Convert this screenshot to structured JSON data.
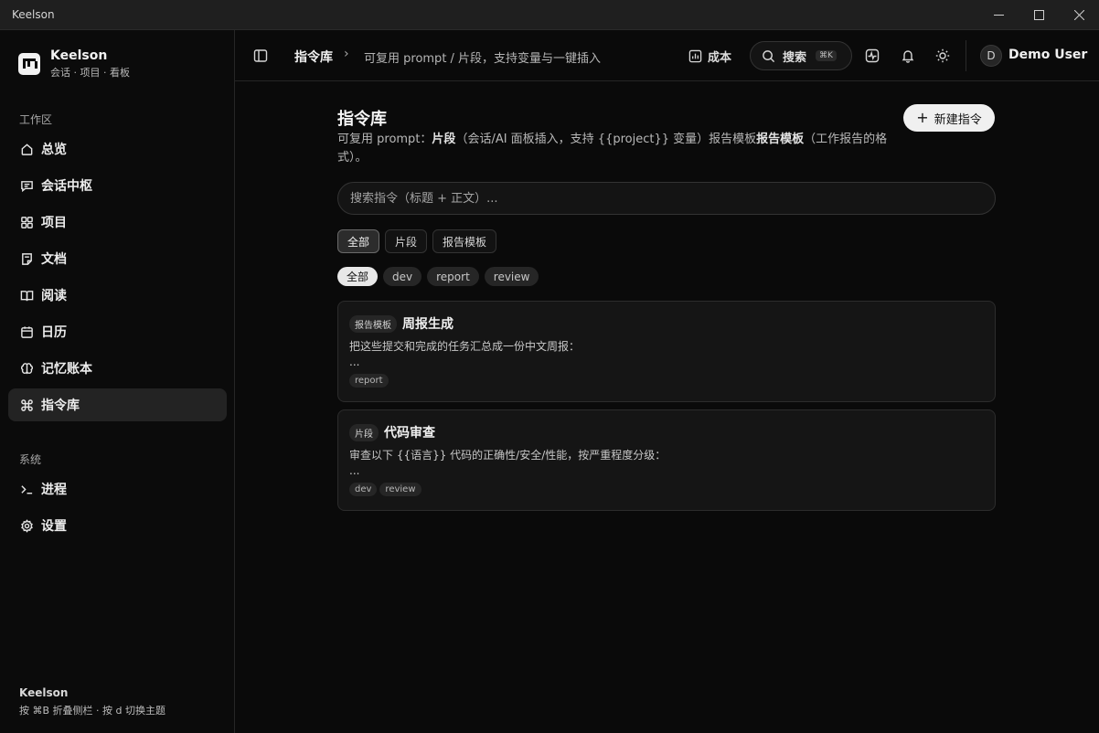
{
  "window": {
    "title": "Keelson",
    "minimize": "—",
    "maximize": "☐",
    "close": "✕"
  },
  "sidebar": {
    "brand_name": "Keelson",
    "brand_sub": "会话 · 项目 · 看板",
    "workspace_label": "工作区",
    "items": [
      {
        "label": "总览",
        "icon": "home-icon"
      },
      {
        "label": "会话中枢",
        "icon": "chat-icon"
      },
      {
        "label": "项目",
        "icon": "grid-icon"
      },
      {
        "label": "文档",
        "icon": "document-icon"
      },
      {
        "label": "阅读",
        "icon": "book-icon"
      },
      {
        "label": "日历",
        "icon": "calendar-icon"
      },
      {
        "label": "记忆账本",
        "icon": "brain-icon"
      },
      {
        "label": "指令库",
        "icon": "command-icon",
        "active": true
      }
    ],
    "system_label": "系统",
    "system_items": [
      {
        "label": "进程",
        "icon": "terminal-icon"
      },
      {
        "label": "设置",
        "icon": "gear-icon"
      }
    ],
    "footer_title": "Keelson",
    "footer_hint": "按 ⌘B 折叠侧栏 · 按 d 切换主题"
  },
  "header": {
    "breadcrumb_main": "指令库",
    "breadcrumb_sep": "›",
    "breadcrumb_desc": "可复用 prompt / 片段，支持变量与一键插入",
    "cost_label": "成本",
    "search_label": "搜索",
    "search_kbd": "⌘K",
    "avatar_initial": "D",
    "user_name": "Demo User"
  },
  "main": {
    "title": "指令库",
    "desc_prefix": "可复用 prompt：",
    "desc_snippet_bold": "片段",
    "desc_middle": "（会话/AI 面板插入，支持 {{project}} 变量）报告模板",
    "desc_template_bold": "报告模板",
    "desc_suffix": "（工作报告的格式）。",
    "new_button": "新建指令",
    "search_placeholder": "搜索指令（标题 + 正文）...",
    "filters": [
      {
        "label": "全部",
        "active": true
      },
      {
        "label": "片段"
      },
      {
        "label": "报告模板"
      }
    ],
    "tags": [
      {
        "label": "全部",
        "active": true
      },
      {
        "label": "dev"
      },
      {
        "label": "report"
      },
      {
        "label": "review"
      }
    ],
    "cards": [
      {
        "badge": "报告模板",
        "title": "周报生成",
        "body": "把这些提交和完成的任务汇总成一份中文周报：\n...",
        "tags": [
          "report"
        ]
      },
      {
        "badge": "片段",
        "title": "代码审查",
        "body": "审查以下 {{语言}} 代码的正确性/安全/性能，按严重程度分级：\n...",
        "tags": [
          "dev",
          "review"
        ]
      }
    ]
  }
}
